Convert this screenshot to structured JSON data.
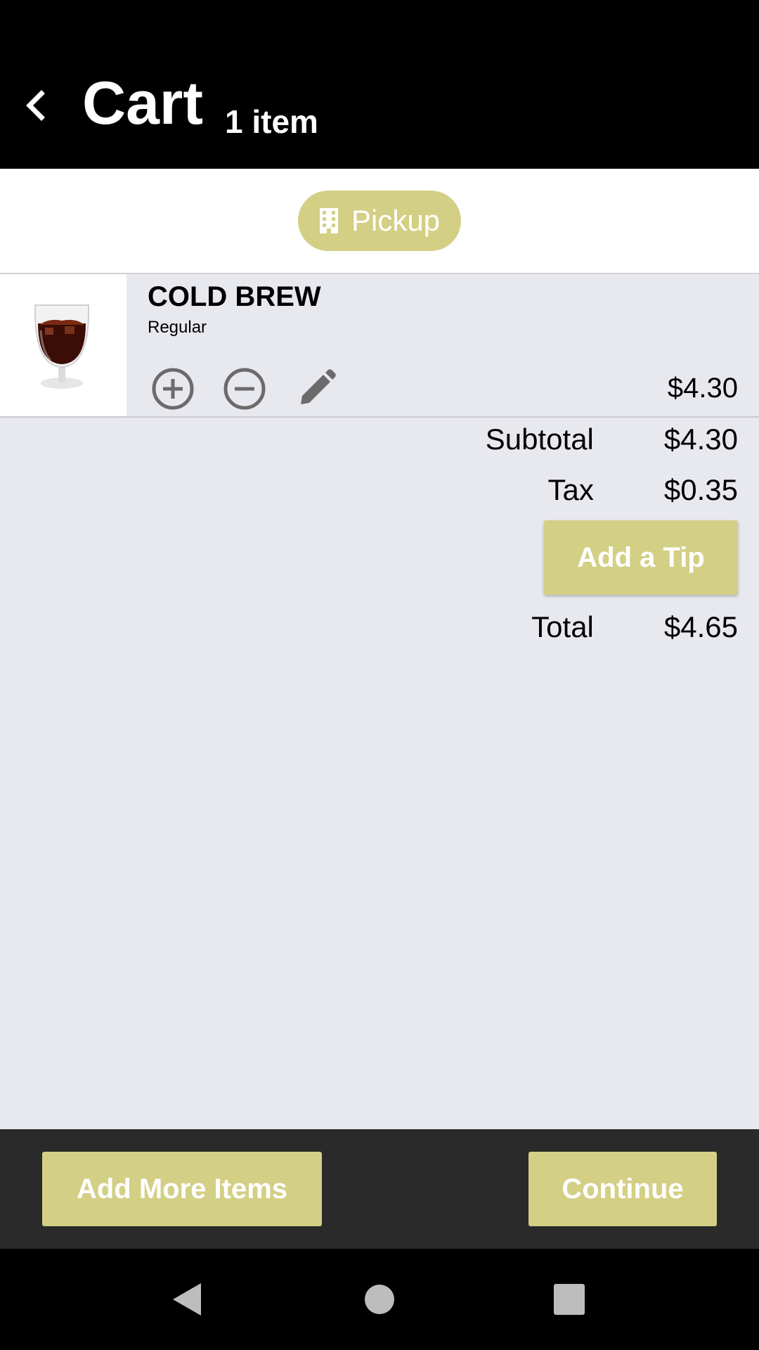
{
  "header": {
    "title": "Cart",
    "item_count": "1 item",
    "back_icon": "chevron-left-icon"
  },
  "mode": {
    "pickup_label": "Pickup",
    "pickup_icon": "building-icon"
  },
  "cart": {
    "items": [
      {
        "name": "COLD BREW",
        "option": "Regular",
        "price": "$4.30",
        "image": "cold-brew-glass-image"
      }
    ]
  },
  "summary": {
    "subtotal_label": "Subtotal",
    "subtotal_value": "$4.30",
    "tax_label": "Tax",
    "tax_value": "$0.35",
    "tip_label": "Add a Tip",
    "total_label": "Total",
    "total_value": "$4.65"
  },
  "actions": {
    "add_more_label": "Add More Items",
    "continue_label": "Continue"
  },
  "colors": {
    "accent": "#d3cf85",
    "header_bg": "#000000",
    "content_bg": "#e8e8ef",
    "action_bar_bg": "#2a2a2a"
  }
}
